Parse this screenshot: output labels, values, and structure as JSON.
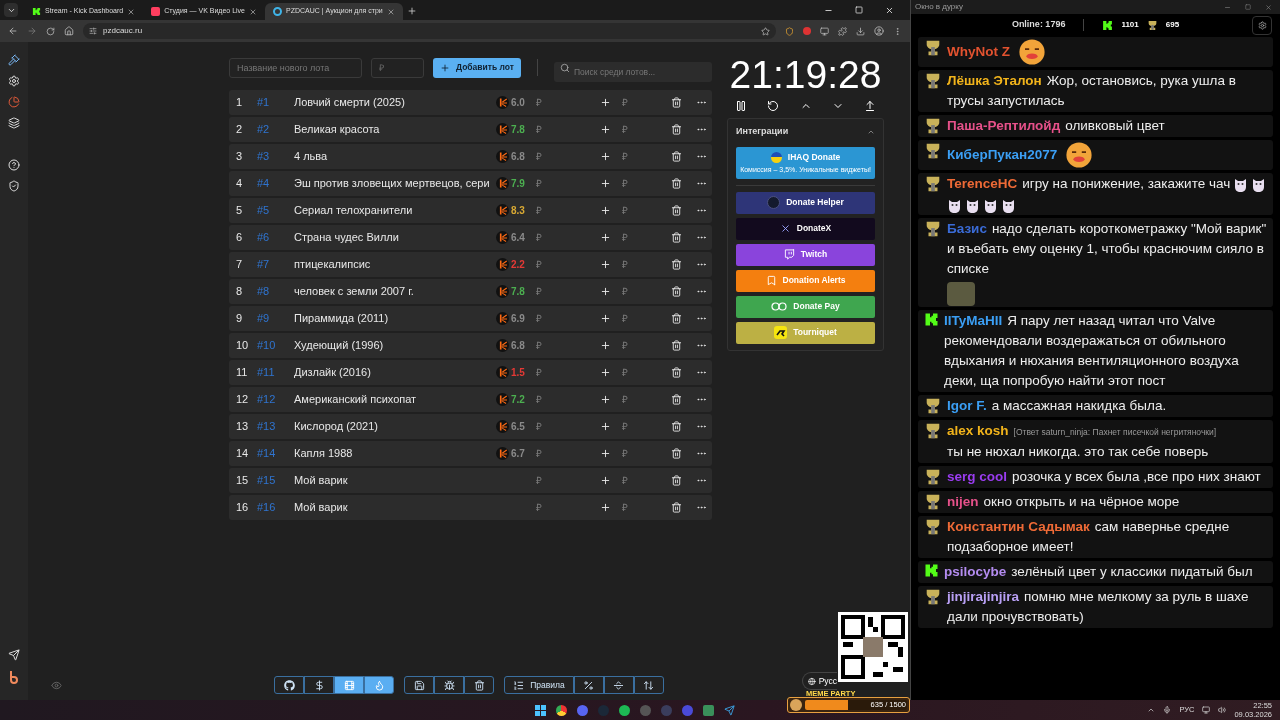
{
  "browser": {
    "tabs": [
      {
        "label": "Stream - Kick Dashboard",
        "selected": false
      },
      {
        "label": "Студия — VK Видео Live",
        "selected": false
      },
      {
        "label": "PZDCAUC | Аукцион для стри",
        "selected": true
      }
    ],
    "address": "pzdcauc.ru"
  },
  "lot_form": {
    "name_placeholder": "Название нового лота",
    "amount_placeholder": "₽",
    "add_button": "Добавить лот",
    "search_placeholder": "Поиск среди лотов..."
  },
  "lots": [
    {
      "index": "1",
      "id": "#1",
      "name": "Ловчий смерти (2025)",
      "rating": "6.0",
      "color": "#8a8a8a",
      "amount_placeholder": "₽",
      "addition_placeholder": "₽"
    },
    {
      "index": "2",
      "id": "#2",
      "name": "Великая красота",
      "rating": "7.8",
      "color": "#4caf50",
      "amount_placeholder": "₽",
      "addition_placeholder": "₽"
    },
    {
      "index": "3",
      "id": "#3",
      "name": "4 льва",
      "rating": "6.8",
      "color": "#8a8a8a",
      "amount_placeholder": "₽",
      "addition_placeholder": "₽"
    },
    {
      "index": "4",
      "id": "#4",
      "name": "Эш против зловещих мертвецов, сери",
      "rating": "7.9",
      "color": "#4caf50",
      "amount_placeholder": "₽",
      "addition_placeholder": "₽"
    },
    {
      "index": "5",
      "id": "#5",
      "name": "Сериал телохранители",
      "rating": "8.3",
      "color": "#d9a933",
      "amount_placeholder": "₽",
      "addition_placeholder": "₽"
    },
    {
      "index": "6",
      "id": "#6",
      "name": "Страна чудес Вилли",
      "rating": "6.4",
      "color": "#8a8a8a",
      "amount_placeholder": "₽",
      "addition_placeholder": "₽"
    },
    {
      "index": "7",
      "id": "#7",
      "name": "птицекалипсис",
      "rating": "2.2",
      "color": "#e53935",
      "amount_placeholder": "₽",
      "addition_placeholder": "₽"
    },
    {
      "index": "8",
      "id": "#8",
      "name": "человек с земли 2007 г.",
      "rating": "7.8",
      "color": "#4caf50",
      "amount_placeholder": "₽",
      "addition_placeholder": "₽"
    },
    {
      "index": "9",
      "id": "#9",
      "name": "Пираммида (2011)",
      "rating": "6.9",
      "color": "#8a8a8a",
      "amount_placeholder": "₽",
      "addition_placeholder": "₽"
    },
    {
      "index": "10",
      "id": "#10",
      "name": "Худеющий (1996)",
      "rating": "6.8",
      "color": "#8a8a8a",
      "amount_placeholder": "₽",
      "addition_placeholder": "₽"
    },
    {
      "index": "11",
      "id": "#11",
      "name": "Дизлайк (2016)",
      "rating": "1.5",
      "color": "#e53935",
      "amount_placeholder": "₽",
      "addition_placeholder": "₽"
    },
    {
      "index": "12",
      "id": "#12",
      "name": "Американский психопат",
      "rating": "7.2",
      "color": "#4caf50",
      "amount_placeholder": "₽",
      "addition_placeholder": "₽"
    },
    {
      "index": "13",
      "id": "#13",
      "name": "Кислород (2021)",
      "rating": "6.5",
      "color": "#8a8a8a",
      "amount_placeholder": "₽",
      "addition_placeholder": "₽"
    },
    {
      "index": "14",
      "id": "#14",
      "name": "Капля 1988",
      "rating": "6.7",
      "color": "#8a8a8a",
      "amount_placeholder": "₽",
      "addition_placeholder": "₽"
    },
    {
      "index": "15",
      "id": "#15",
      "name": "Мой варик",
      "amount_placeholder": "₽",
      "addition_placeholder": "₽"
    },
    {
      "index": "16",
      "id": "#16",
      "name": "Мой варик",
      "amount_placeholder": "₽",
      "addition_placeholder": "₽"
    }
  ],
  "timer": "21:19:28",
  "integrations": {
    "title": "Интеграции",
    "expanded": true,
    "items": [
      {
        "kind": "ihaq",
        "label": "IHAQ Donate",
        "subtitle": "Комиссия – 3,5%. Уникальные виджеты!",
        "color": "#2b96d3"
      },
      {
        "kind": "helper",
        "label": "Donate Helper",
        "color": "#2e3578"
      },
      {
        "kind": "x",
        "label": "DonateX",
        "color": "#120a1e"
      },
      {
        "kind": "twitch",
        "label": "Twitch",
        "color": "#8a44dc"
      },
      {
        "kind": "alerts",
        "label": "Donation Alerts",
        "color": "#f47f0f"
      },
      {
        "kind": "pay",
        "label": "Donate Pay",
        "color": "#3fa64f"
      },
      {
        "kind": "tourniquet",
        "label": "Tourniquet",
        "color": "#bcb044"
      }
    ]
  },
  "toolbar": [
    {
      "buttons": [
        {
          "kind": "github",
          "selected": false
        },
        {
          "kind": "dollar",
          "selected": false
        },
        {
          "kind": "film",
          "selected": true
        },
        {
          "kind": "fire",
          "selected": true
        }
      ]
    },
    {
      "buttons": [
        {
          "kind": "save",
          "selected": false
        },
        {
          "kind": "bug",
          "selected": false
        },
        {
          "kind": "trash",
          "selected": false
        }
      ]
    },
    {
      "buttons": [
        {
          "kind": "rules",
          "label": "Правила",
          "selected": false
        },
        {
          "kind": "percent",
          "selected": false
        },
        {
          "kind": "split",
          "selected": false
        },
        {
          "kind": "sort",
          "selected": false
        }
      ]
    }
  ],
  "language": "Русс",
  "meme_party": {
    "title": "MEME PARTY",
    "progress": "635 / 1500",
    "level": 0.42
  },
  "chat": {
    "title": "Окно в дурку",
    "online": "Online: 1796",
    "kick_count": "1101",
    "trophy_count": "695",
    "messages": [
      {
        "kind": "trophy",
        "name": "WhyNot Z",
        "color": "#e2522f",
        "emotes": [
          {
            "kind": "face"
          }
        ]
      },
      {
        "kind": "trophy",
        "name": "Лёшка Эталон",
        "color": "#f2b41b",
        "text": "Жор, остановись, рука ушла в трусы запустилась"
      },
      {
        "kind": "trophy",
        "name": "Паша-Рептилойд",
        "color": "#e6518a",
        "text": "оливковый цвет"
      },
      {
        "kind": "trophy",
        "name": "КиберПукан2077",
        "color": "#3b9ff5",
        "emotes": [
          {
            "kind": "face"
          }
        ]
      },
      {
        "kind": "trophy",
        "name": "TerenceHC",
        "color": "#ee6a36",
        "text": "игру на понижение, закажите чач",
        "emotes": [
          {
            "kind": "cat"
          },
          {
            "kind": "cat"
          },
          {
            "kind": "cat"
          },
          {
            "kind": "cat"
          },
          {
            "kind": "cat"
          },
          {
            "kind": "cat"
          }
        ]
      },
      {
        "kind": "trophy",
        "name": "Базис",
        "color": "#3a6bd6",
        "text": "надо сделать короткометражку \"Мой варик\" и въебать ему оценку 1, чтобы краснючим сияло в списке",
        "emotes": [
          {
            "kind": "picture"
          }
        ]
      },
      {
        "kind": "kick",
        "name": "IITyMaHII",
        "color": "#3b9ff5",
        "text": "Я пару лет назад читал что Valve рекомендовали воздеражаться от обильного вдыхания и нюхания вентиляционного воздуха деки, ща попробую найти этот пост"
      },
      {
        "kind": "trophy",
        "name": "Igor F.",
        "color": "#3b9ff5",
        "text": "а массажная накидка была."
      },
      {
        "kind": "trophy",
        "name": "alex kosh",
        "color": "#f2b41b",
        "reply": "[Ответ saturn_ninja: Пахнет писечкой негритяночки]",
        "text": "ты не нюхал никогда. это так себе поверь"
      },
      {
        "kind": "trophy",
        "name": "serg cool",
        "color": "#9a3cf0",
        "text": "розочка у всех была ,все про них знают"
      },
      {
        "kind": "trophy",
        "name": "nijen",
        "color": "#e6518a",
        "text": "окно открыть и на чёрное море"
      },
      {
        "kind": "trophy",
        "name": "Константин Садымак",
        "color": "#ee6a36",
        "text": "сам навернье средне подзаборное имеет!"
      },
      {
        "kind": "kick",
        "name": "psilocybe",
        "color": "#b48cf0",
        "text": "зелёный цвет у классики пидатый был"
      },
      {
        "kind": "trophy",
        "name": "jinjirajinjira",
        "color": "#b9a0f5",
        "text": "помню мне мелкому за руль в шахе дали прочувствовать)"
      }
    ]
  },
  "taskbar": {
    "lang": "РУС",
    "time": "22:55",
    "date": "09.03.2026"
  }
}
